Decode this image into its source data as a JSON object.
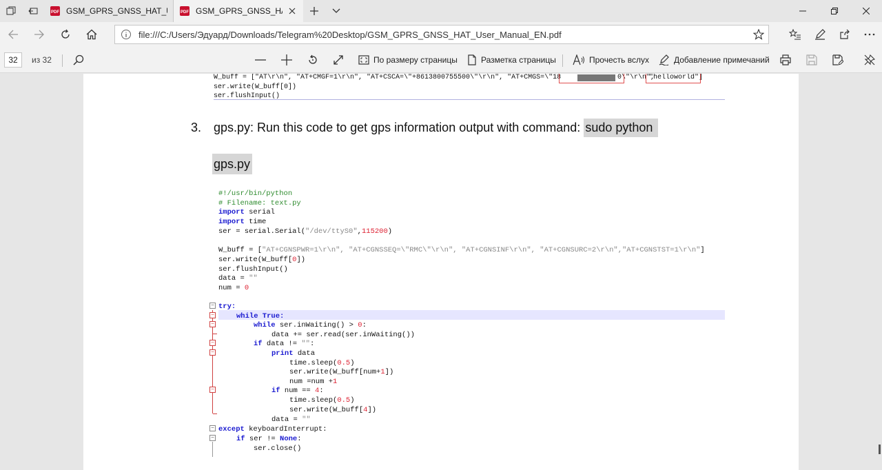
{
  "browser": {
    "tabs": [
      {
        "title": "GSM_GPRS_GNSS_HAT_Use",
        "active": false
      },
      {
        "title": "GSM_GPRS_GNSS_HAT_",
        "active": true
      }
    ],
    "url": "file:///C:/Users/Эдуард/Downloads/Telegram%20Desktop/GSM_GPRS_GNSS_HAT_User_Manual_EN.pdf"
  },
  "pdf_toolbar": {
    "page_current": "32",
    "page_total": "из 32",
    "fit_page": "По размеру страницы",
    "page_layout": "Разметка страницы",
    "read_aloud": "Прочесть вслух",
    "add_notes": "Добавление примечаний"
  },
  "document": {
    "top_code": {
      "line1_a": "W_buff = [\"AT\\r\\n\", \"AT+CMGF=1\\r\\n\", \"AT+CSCA=\\\"+8613800755500\\\"\\r\\n\", \"AT+CMGS=\\\"18",
      "line1_b": "0\\\"\\r\\n\",",
      "line1_c": "\"helloworld\"]",
      "line2": "ser.write(W_buff[0])",
      "line3": "ser.flushInput()"
    },
    "step_number": "3.",
    "step_text": "gps.py: Run this code to get gps information output with command:",
    "command_part1": "sudo python",
    "command_part2": "gps.py",
    "code_lines": {
      "l1": "#!/usr/bin/python",
      "l2": "# Filename: text.py",
      "l3_kw": "import",
      "l3": " serial",
      "l4_kw": "import",
      "l4": " time",
      "l5_a": "ser = serial.Serial(",
      "l5_str": "\"/dev/ttyS0\"",
      "l5_b": ",",
      "l5_num": "115200",
      "l5_c": ")",
      "l6_a": "W_buff = [",
      "l6_str": "\"AT+CGNSPWR=1\\r\\n\", \"AT+CGNSSEQ=\\\"RMC\\\"\\r\\n\", \"AT+CGNSINF\\r\\n\", \"AT+CGNSURC=2\\r\\n\",\"AT+CGNSTST=1\\r\\n\"",
      "l6_b": "]",
      "l7_a": "ser.write(W_buff[",
      "l7_num": "0",
      "l7_b": "])",
      "l8": "ser.flushInput()",
      "l9_a": "data = ",
      "l9_str": "\"\"",
      "l10_a": "num = ",
      "l10_num": "0",
      "l11": "try:",
      "l12": "while True:",
      "l13_kw": "while",
      "l13_a": " ser.inWaiting() > ",
      "l13_num": "0",
      "l13_b": ":",
      "l14": "data += ser.read(ser.inWaiting())",
      "l15_kw": "if",
      "l15_a": " data != ",
      "l15_str": "\"\"",
      "l15_b": ":",
      "l16_kw": "print",
      "l16_a": " data",
      "l17_a": "time.sleep(",
      "l17_num": "0.5",
      "l17_b": ")",
      "l18_a": "ser.write(W_buff[num+",
      "l18_num": "1",
      "l18_b": "])",
      "l19_a": "num =num +",
      "l19_num": "1",
      "l20_kw": "if",
      "l20_a": " num == ",
      "l20_num": "4",
      "l20_b": ":",
      "l21_a": "time.sleep(",
      "l21_num": "0.5",
      "l21_b": ")",
      "l22_a": "ser.write(W_buff[",
      "l22_num": "4",
      "l22_b": "])",
      "l23_a": "data = ",
      "l23_str": "\"\"",
      "l24_kw": "except",
      "l24_a": " keyboardInterrupt:",
      "l25_kw": "if",
      "l25_a": " ser != ",
      "l25_kw2": "None",
      "l25_b": ":",
      "l26": "ser.close()"
    }
  },
  "colors": {
    "code_comment": "#2e8b2e",
    "code_keyword": "#1a1ad0",
    "code_number": "#dd2233",
    "code_string": "#888888",
    "highlight": "#d6d6d6",
    "pdf_icon": "#c8102e"
  }
}
